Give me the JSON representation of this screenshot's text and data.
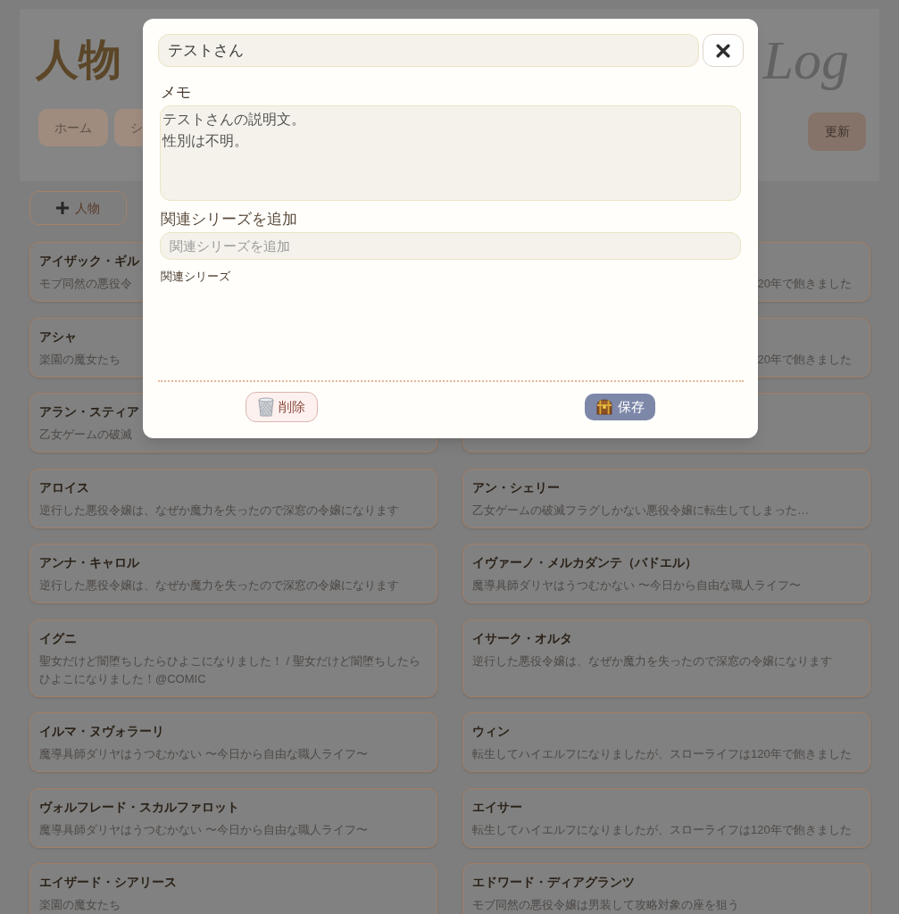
{
  "header": {
    "title": "人物",
    "logo_text": "Log",
    "nav": [
      {
        "label": "ホーム"
      },
      {
        "label": "シ"
      }
    ],
    "refresh_button": "更新"
  },
  "toolbar": {
    "add_button": "人物"
  },
  "card_rows": [
    [
      {
        "name": "アイザック・ギル",
        "description": "モブ同然の悪役令"
      },
      {
        "description": "20年で飽きました"
      }
    ],
    [
      {
        "name": "アシャ",
        "description": "楽園の魔女たち"
      },
      {
        "description": "20年で飽きました"
      }
    ],
    [
      {
        "name": "アラン・スティア",
        "description": "乙女ゲームの破滅"
      }
    ],
    [
      {
        "name": "アロイス",
        "description": "逆行した悪役令嬢は、なぜか魔力を失ったので深窓の令嬢になります"
      },
      {
        "name": "アン・シェリー",
        "description": "乙女ゲームの破滅フラグしかない悪役令嬢に転生してしまった…"
      }
    ],
    [
      {
        "name": "アンナ・キャロル",
        "description": "逆行した悪役令嬢は、なぜか魔力を失ったので深窓の令嬢になります"
      },
      {
        "name": "イヴァーノ・メルカダンテ（バドエル）",
        "description": "魔導具師ダリヤはうつむかない 〜今日から自由な職人ライフ〜"
      }
    ],
    [
      {
        "name": "イグニ",
        "description": "聖女だけど闇堕ちしたらひよこになりました！ / 聖女だけど闇堕ちしたらひよこになりました！@COMIC"
      },
      {
        "name": "イサーク・オルタ",
        "description": "逆行した悪役令嬢は、なぜか魔力を失ったので深窓の令嬢になります"
      }
    ],
    [
      {
        "name": "イルマ・ヌヴォラーリ",
        "description": "魔導具師ダリヤはうつむかない 〜今日から自由な職人ライフ〜"
      },
      {
        "name": "ウィン",
        "description": "転生してハイエルフになりましたが、スローライフは120年で飽きました"
      }
    ],
    [
      {
        "name": "ヴォルフレード・スカルファロット",
        "description": "魔導具師ダリヤはうつむかない 〜今日から自由な職人ライフ〜"
      },
      {
        "name": "エイサー",
        "description": "転生してハイエルフになりましたが、スローライフは120年で飽きました"
      }
    ],
    [
      {
        "name": "エイザード・シアリース",
        "description": "楽園の魔女たち"
      },
      {
        "name": "エドワード・ディアグランツ",
        "description": "モブ同然の悪役令嬢は男装して攻略対象の座を狙う"
      }
    ]
  ],
  "dialog": {
    "name_value": "テストさん",
    "memo_label": "メモ",
    "memo_lines": [
      "テストさんの説明文。",
      "性別は不明。"
    ],
    "series_label": "関連シリーズを追加",
    "series_placeholder": "関連シリーズを追加",
    "related_label": "関連シリーズ",
    "buttons": [
      {
        "kind": "delete",
        "label": "削除"
      },
      {
        "kind": "save",
        "label": "保存"
      }
    ]
  }
}
